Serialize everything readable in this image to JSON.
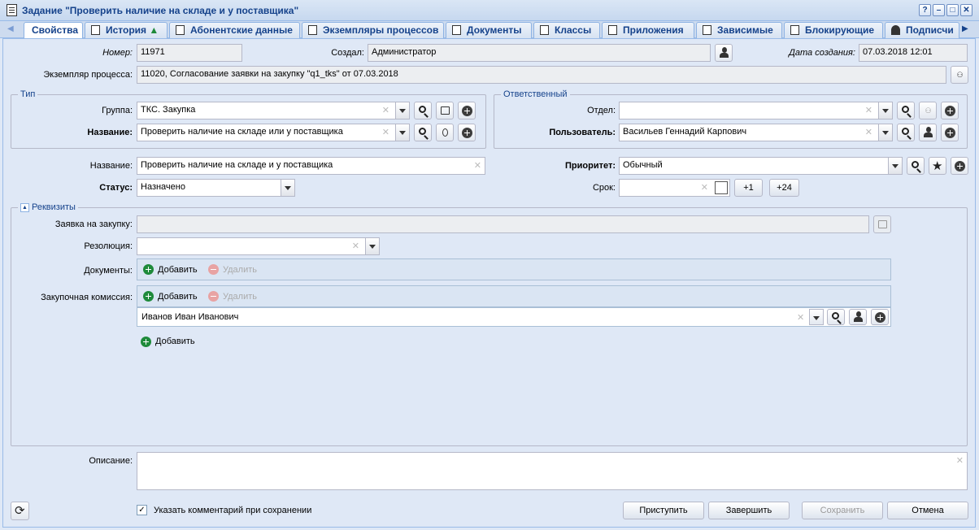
{
  "window": {
    "title": "Задание \"Проверить наличие на складе и у поставщика\"",
    "help": "?"
  },
  "tabs": [
    {
      "label": "Свойства",
      "icon": "none"
    },
    {
      "label": "История",
      "icon": "history-icon"
    },
    {
      "label": "Абонентские данные",
      "icon": "document-icon"
    },
    {
      "label": "Экземпляры процессов",
      "icon": "process-icon"
    },
    {
      "label": "Документы",
      "icon": "documents-icon"
    },
    {
      "label": "Классы",
      "icon": "classes-icon"
    },
    {
      "label": "Приложения",
      "icon": "attachments-icon"
    },
    {
      "label": "Зависимые",
      "icon": "dependents-icon"
    },
    {
      "label": "Блокирующие",
      "icon": "blocking-icon"
    },
    {
      "label": "Подписчи",
      "icon": "user-icon"
    }
  ],
  "header": {
    "number_label": "Номер:",
    "number": "11971",
    "created_by_label": "Создал:",
    "created_by": "Администратор",
    "created_date_label": "Дата создания:",
    "created_date": "07.03.2018 12:01",
    "process_label": "Экземпляр процесса:",
    "process": "11020, Согласование заявки на закупку \"q1_tks\" от 07.03.2018"
  },
  "type_group": {
    "legend": "Тип",
    "group_label": "Группа:",
    "group": "ТКС. Закупка",
    "name_label": "Название:",
    "name": "Проверить наличие на складе или у поставщика"
  },
  "responsible": {
    "legend": "Ответственный",
    "dept_label": "Отдел:",
    "dept": "",
    "user_label": "Пользователь:",
    "user": "Васильев Геннадий Карпович"
  },
  "main": {
    "title_label": "Название:",
    "title": "Проверить наличие на складе и у поставщика",
    "status_label": "Статус:",
    "status": "Назначено",
    "priority_label": "Приоритет:",
    "priority": "Обычный",
    "due_label": "Срок:",
    "due": "",
    "plus1": "+1",
    "plus24": "+24"
  },
  "requisites": {
    "legend": "Реквизиты",
    "request_label": "Заявка на закупку:",
    "request": "",
    "resolution_label": "Резолюция:",
    "resolution": "",
    "docs_label": "Документы:",
    "add": "Добавить",
    "remove": "Удалить",
    "commission_label": "Закупочная комиссия:",
    "commission_member": "Иванов Иван Иванович"
  },
  "description_label": "Описание:",
  "footer": {
    "comment_checkbox": "Указать комментарий при сохранении",
    "start": "Приступить",
    "finish": "Завершить",
    "save": "Сохранить",
    "cancel": "Отмена"
  }
}
